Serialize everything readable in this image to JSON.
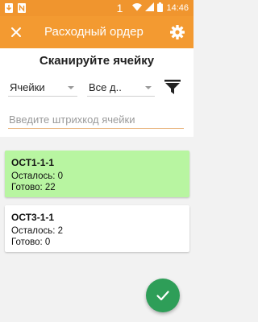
{
  "status_bar": {
    "sim_number": "1",
    "time": "14:46",
    "icons": [
      "download-icon",
      "notification-n-icon",
      "wifi-icon",
      "signal-icon",
      "battery-icon"
    ]
  },
  "app_bar": {
    "title": "Расходный ордер",
    "close_icon": "close-icon",
    "settings_icon": "gear-icon",
    "color": "#f39a31"
  },
  "scan": {
    "heading": "Сканируйте ячейку",
    "filter_cells": {
      "selected": "Ячейки"
    },
    "filter_all": {
      "selected": "Все д.."
    },
    "filter_icon": "filter-icon",
    "barcode": {
      "value": "",
      "placeholder": "Введите штрихкод ячейки"
    }
  },
  "cells": [
    {
      "name": "ОСТ1-1-1",
      "remaining": "Осталось: 0",
      "ready": "Готово: 22",
      "highlight": "#b8f5a1"
    },
    {
      "name": "ОСТ3-1-1",
      "remaining": "Осталось: 2",
      "ready": "Готово: 0",
      "highlight": "#ffffff"
    }
  ],
  "fab": {
    "icon": "check-icon",
    "color": "#2e9e58"
  }
}
